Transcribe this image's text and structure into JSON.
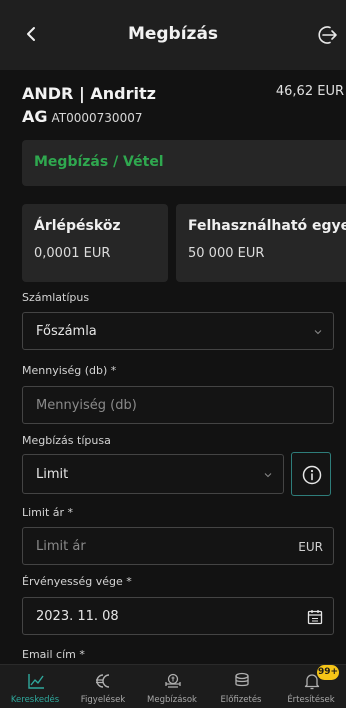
{
  "header": {
    "title": "Megbízás",
    "back_icon": "chevron-left-icon",
    "logout_icon": "logout-icon"
  },
  "instrument": {
    "name_line1": "ANDR | Andritz",
    "name_line2": "AG",
    "isin": "AT0000730007",
    "price": "46,62 EUR"
  },
  "order": {
    "label": "Megbízás / Vétel",
    "color": "#2fa84f"
  },
  "info_cards": [
    {
      "title": "Árlépésköz",
      "value": "0,0001 EUR"
    },
    {
      "title": "Felhasználható egye",
      "value": "50 000 EUR"
    }
  ],
  "form": {
    "account_type": {
      "label": "Számlatípus",
      "value": "Főszámla"
    },
    "quantity": {
      "label": "Mennyiség (db) *",
      "placeholder": "Mennyiség (db)"
    },
    "order_type": {
      "label": "Megbízás típusa",
      "value": "Limit"
    },
    "limit_price": {
      "label": "Limit ár *",
      "placeholder": "Limit ár",
      "currency": "EUR"
    },
    "valid_until": {
      "label": "Érvényesség vége *",
      "value": "2023. 11. 08"
    },
    "email": {
      "label": "Email cím *"
    }
  },
  "bottom_nav": {
    "items": [
      {
        "label": "Kereskedés",
        "icon": "chart-line-icon",
        "active": true
      },
      {
        "label": "Figyelések",
        "icon": "currency-watch-icon",
        "active": false
      },
      {
        "label": "Megbízások",
        "icon": "orders-icon",
        "active": false
      },
      {
        "label": "Előfizetés",
        "icon": "stack-icon",
        "active": false
      },
      {
        "label": "Értesítések",
        "icon": "bell-icon",
        "active": false,
        "badge": "99+"
      }
    ]
  },
  "colors": {
    "accent": "#2fa89c",
    "buy": "#2fa84f",
    "badge": "#f5c518"
  }
}
